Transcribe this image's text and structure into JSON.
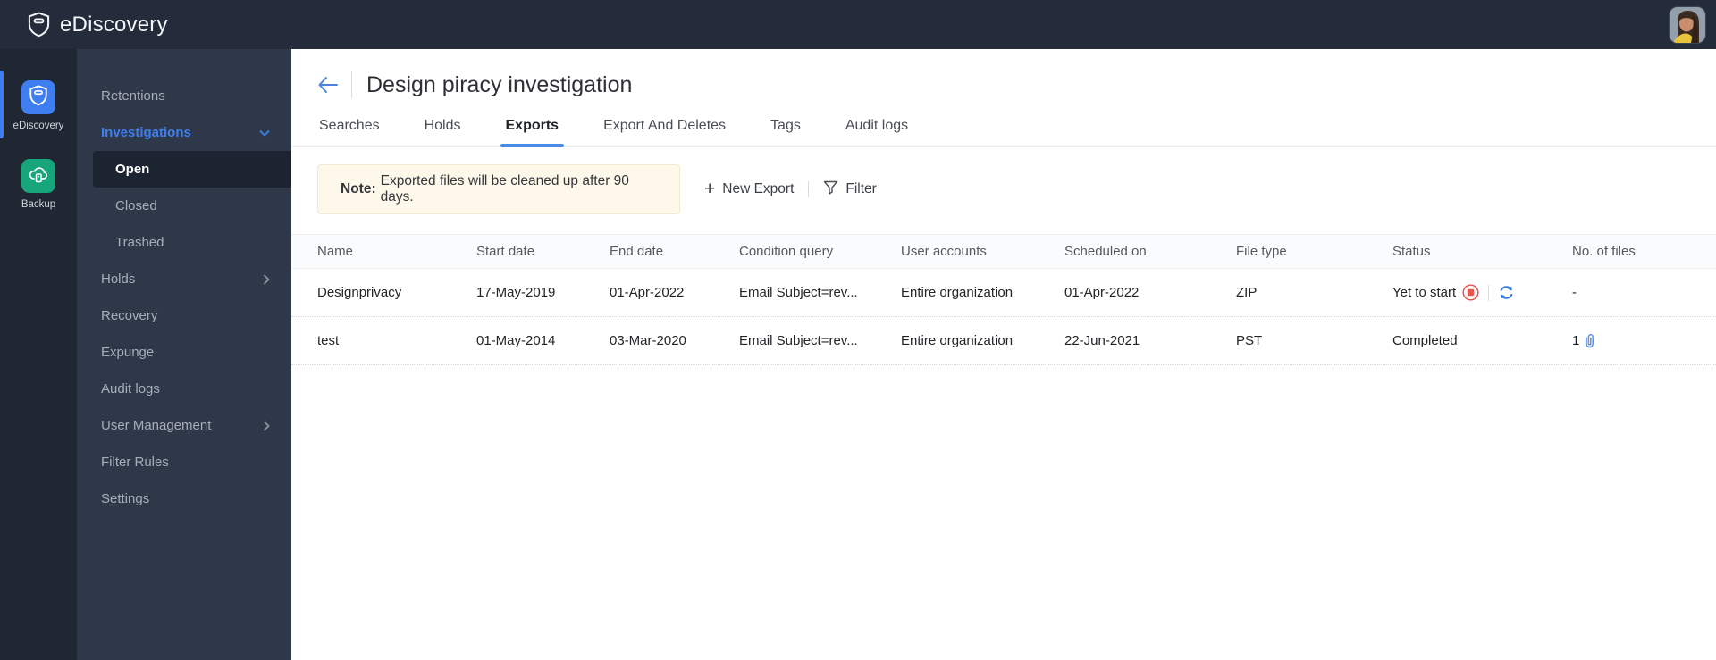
{
  "topbar": {
    "app_title": "eDiscovery"
  },
  "rail": {
    "items": [
      {
        "label": "eDiscovery",
        "active": true,
        "icon": "shield-icon",
        "tile_color": "#3f7ef0"
      },
      {
        "label": "Backup",
        "active": false,
        "icon": "cloud-backup-icon",
        "tile_color": "#17a57c"
      }
    ]
  },
  "sidebar": {
    "items": [
      {
        "label": "Retentions"
      },
      {
        "label": "Investigations",
        "expanded": true,
        "active": true
      },
      {
        "label": "Open",
        "sub": true,
        "selected": true
      },
      {
        "label": "Closed",
        "sub": true
      },
      {
        "label": "Trashed",
        "sub": true
      },
      {
        "label": "Holds",
        "chevron": "right"
      },
      {
        "label": "Recovery"
      },
      {
        "label": "Expunge"
      },
      {
        "label": "Audit logs"
      },
      {
        "label": "User Management",
        "chevron": "right"
      },
      {
        "label": "Filter Rules"
      },
      {
        "label": "Settings"
      }
    ]
  },
  "main": {
    "page_title": "Design piracy investigation",
    "back_icon": "back-arrow-icon",
    "tabs": [
      {
        "label": "Searches",
        "active": false
      },
      {
        "label": "Holds",
        "active": false
      },
      {
        "label": "Exports",
        "active": true
      },
      {
        "label": "Export And Deletes",
        "active": false
      },
      {
        "label": "Tags",
        "active": false
      },
      {
        "label": "Audit logs",
        "active": false
      }
    ],
    "note": {
      "prefix": "Note:",
      "text": "Exported files will be cleaned up after 90 days."
    },
    "toolbar": {
      "new_export_label": "New Export",
      "filter_label": "Filter"
    },
    "table": {
      "columns": [
        "Name",
        "Start date",
        "End date",
        "Condition query",
        "User accounts",
        "Scheduled on",
        "File type",
        "Status",
        "No. of files"
      ],
      "rows": [
        {
          "name": "Designprivacy",
          "start_date": "17-May-2019",
          "end_date": "01-Apr-2022",
          "condition_query": "Email Subject=rev...",
          "user_accounts": "Entire organization",
          "scheduled_on": "01-Apr-2022",
          "file_type": "ZIP",
          "status": "Yet to start",
          "status_icons": [
            "stop-icon",
            "refresh-icon"
          ],
          "files": "-"
        },
        {
          "name": "test",
          "start_date": "01-May-2014",
          "end_date": "03-Mar-2020",
          "condition_query": "Email Subject=rev...",
          "user_accounts": "Entire organization",
          "scheduled_on": "22-Jun-2021",
          "file_type": "PST",
          "status": "Completed",
          "status_icons": [],
          "files": "1",
          "files_icon": "paperclip-icon"
        }
      ]
    }
  },
  "colors": {
    "topbar_bg": "#242c3b",
    "rail_bg": "#1f2733",
    "sidebar_bg": "#2e3848",
    "selected_item_bg": "#1d2431",
    "accent_blue": "#3f7ef0",
    "tab_underline": "#4a8ce8",
    "backup_green": "#17a57c",
    "note_bg": "#fdf8e9",
    "stop_red": "#e4574e",
    "refresh_blue": "#2e7ce8",
    "paperclip_blue": "#5b8fe8"
  }
}
